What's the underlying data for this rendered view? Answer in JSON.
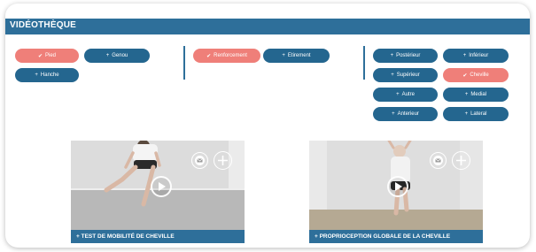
{
  "header": {
    "title": "VIDÉOTHÈQUE"
  },
  "filters": {
    "group_body": [
      {
        "label": "Pied",
        "active": true
      },
      {
        "label": "Genou",
        "active": false
      },
      {
        "label": "Hanche",
        "active": false
      }
    ],
    "group_type": [
      {
        "label": "Renforcement",
        "active": true
      },
      {
        "label": "Etirement",
        "active": false
      }
    ],
    "group_direction": [
      {
        "label": "Postérieur",
        "active": false
      },
      {
        "label": "Inférieur",
        "active": false
      },
      {
        "label": "Supérieur",
        "active": false
      },
      {
        "label": "Cheville",
        "active": true
      },
      {
        "label": "Autre",
        "active": false
      },
      {
        "label": "Medial",
        "active": false
      },
      {
        "label": "Anterieur",
        "active": false
      },
      {
        "label": "Lateral",
        "active": false
      }
    ]
  },
  "videos": [
    {
      "title": "+ TEST DE MOBILITÉ DE CHEVILLE"
    },
    {
      "title": "+ PROPRIOCEPTION GLOBALE DE LA CHEVILLE"
    }
  ],
  "icons": {
    "check": "✔",
    "plus": "+",
    "message": "envelope-icon",
    "add": "plus-icon",
    "play": "play-icon"
  },
  "colors": {
    "primary": "#24668f",
    "header": "#2e6f9a",
    "active": "#ef7f79"
  }
}
